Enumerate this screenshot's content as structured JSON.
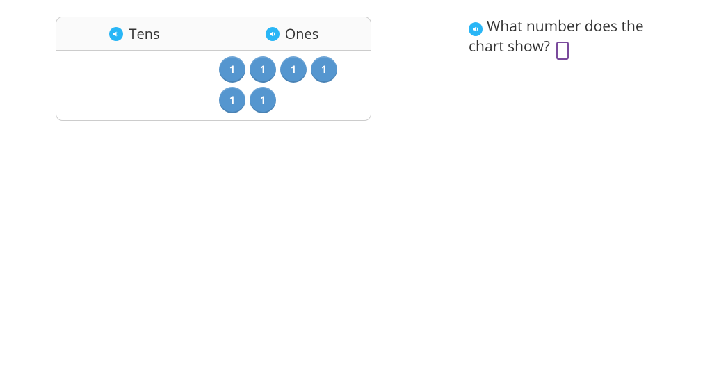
{
  "chart": {
    "columns": {
      "tens_label": "Tens",
      "ones_label": "Ones"
    },
    "tens_chips": [],
    "ones_chips": [
      "1",
      "1",
      "1",
      "1",
      "1",
      "1"
    ]
  },
  "question": {
    "text_part1": "What number does the chart show?",
    "answer_value": ""
  },
  "icons": {
    "tts": "speaker-icon"
  }
}
